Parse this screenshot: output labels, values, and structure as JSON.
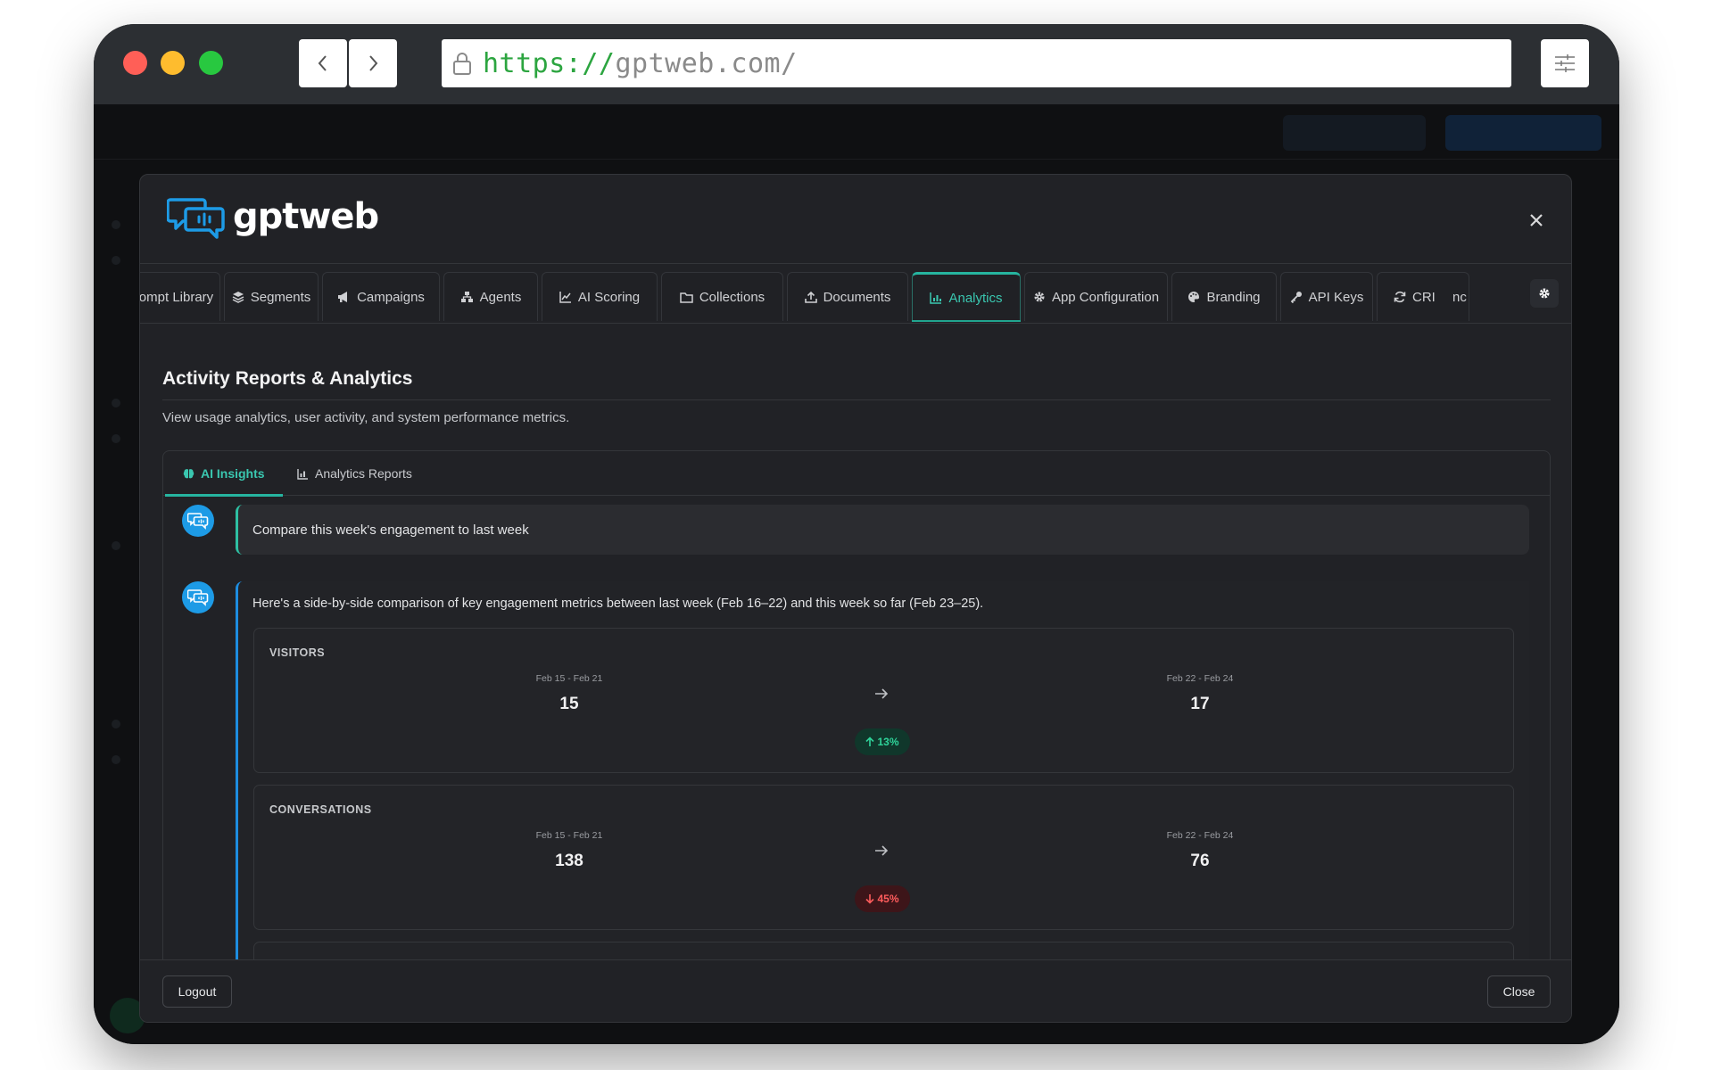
{
  "browser": {
    "url_protocol": "https://",
    "url_host": "gptweb.com/"
  },
  "brand": {
    "name": "gptweb",
    "color": "#1d9be6"
  },
  "tabs": [
    {
      "label": "rompt Library",
      "icon": "book-icon"
    },
    {
      "label": "Segments",
      "icon": "layers-icon"
    },
    {
      "label": "Campaigns",
      "icon": "megaphone-icon"
    },
    {
      "label": "Agents",
      "icon": "sitemap-icon"
    },
    {
      "label": "AI Scoring",
      "icon": "line-chart-icon"
    },
    {
      "label": "Collections",
      "icon": "folder-icon"
    },
    {
      "label": "Documents",
      "icon": "upload-icon"
    },
    {
      "label": "Analytics",
      "icon": "bar-chart-icon",
      "active": true
    },
    {
      "label": "App Configuration",
      "icon": "gear-icon"
    },
    {
      "label": "Branding",
      "icon": "palette-icon"
    },
    {
      "label": "API Keys",
      "icon": "key-icon"
    },
    {
      "label": "CRI",
      "icon": "sync-icon"
    }
  ],
  "tabs_overflow_text": "nc",
  "page": {
    "title": "Activity Reports & Analytics",
    "description": "View usage analytics, user activity, and system performance metrics."
  },
  "subtabs": [
    {
      "label": "AI Insights",
      "icon": "brain-icon",
      "active": true
    },
    {
      "label": "Analytics Reports",
      "icon": "bar-chart-icon"
    }
  ],
  "chat": {
    "user_message": "Compare this week's engagement to last week",
    "bot_intro": "Here's a side-by-side comparison of key engagement metrics between last week (Feb 16–22) and this week so far (Feb 23–25).",
    "metrics": [
      {
        "title": "VISITORS",
        "prev_period": "Feb 15 - Feb 21",
        "prev_value": "15",
        "curr_period": "Feb 22 - Feb 24",
        "curr_value": "17",
        "change": "13%",
        "direction": "up"
      },
      {
        "title": "CONVERSATIONS",
        "prev_period": "Feb 15 - Feb 21",
        "prev_value": "138",
        "curr_period": "Feb 22 - Feb 24",
        "curr_value": "76",
        "change": "45%",
        "direction": "down"
      }
    ]
  },
  "footer": {
    "logout": "Logout",
    "close": "Close"
  },
  "colors": {
    "accent_teal": "#26b5a0",
    "accent_blue": "#1d9be6",
    "up": "#2fd49a",
    "down": "#ff5c5c"
  }
}
